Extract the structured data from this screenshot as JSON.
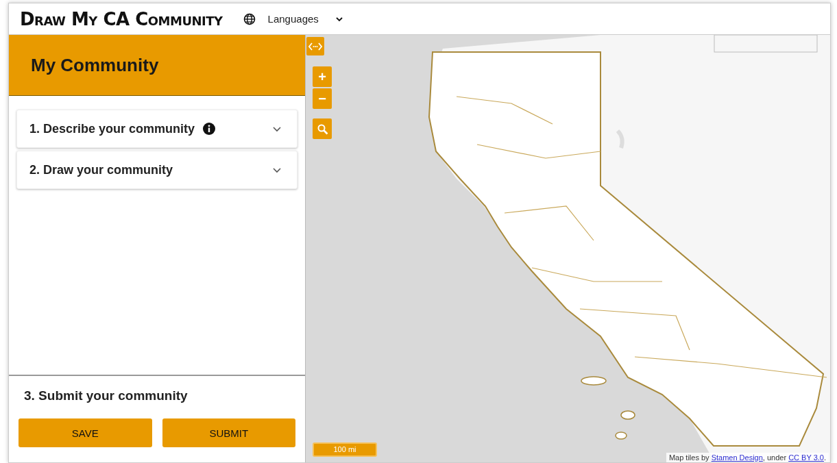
{
  "header": {
    "title": "Draw My CA Community",
    "language_menu": "Languages"
  },
  "panel": {
    "title": "My Community",
    "sections": [
      {
        "label": "1. Describe your community",
        "info": true,
        "expanded": false
      },
      {
        "label": "2. Draw your community",
        "info": false,
        "expanded": false
      }
    ],
    "submit_title": "3. Submit your community",
    "buttons": [
      "SAVE",
      "SUBMIT"
    ]
  },
  "map": {
    "kind": "picture",
    "zoom_in": "+",
    "zoom_out": "−",
    "scale": "100 mi",
    "attribution": [
      {
        "text": "Map tiles by ",
        "link": false
      },
      {
        "text": "Stamen Design",
        "link": true
      },
      {
        "text": ", under ",
        "link": false
      },
      {
        "text": "CC BY 3.0",
        "link": true
      },
      {
        "text": ".",
        "link": false
      }
    ]
  }
}
